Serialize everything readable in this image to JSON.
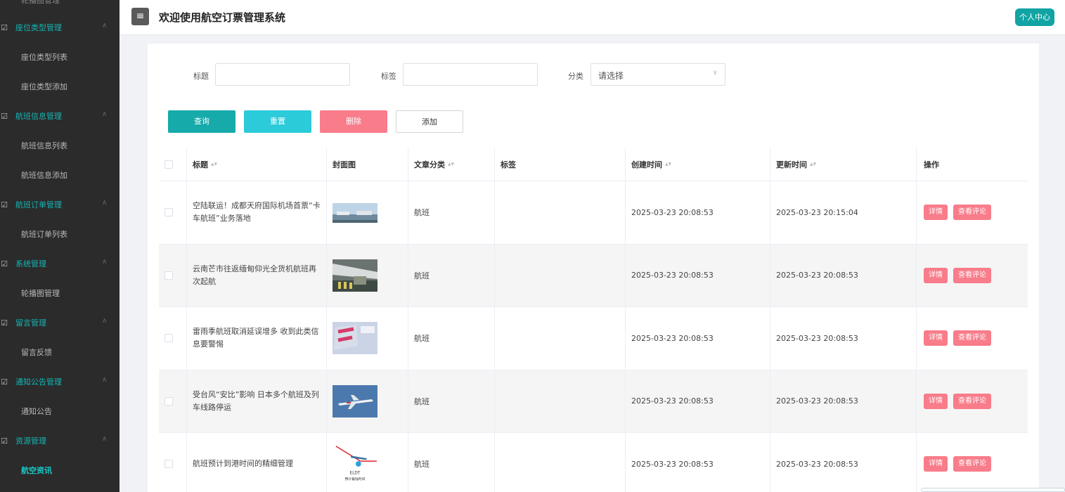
{
  "sidebar": {
    "top_item": "轮播图管理",
    "items": [
      {
        "type": "group",
        "label": "座位类型管理",
        "icon": "checkbox-icon"
      },
      {
        "type": "item",
        "label": "座位类型列表"
      },
      {
        "type": "item",
        "label": "座位类型添加"
      },
      {
        "type": "group",
        "label": "航班信息管理",
        "icon": "checkbox-icon"
      },
      {
        "type": "item",
        "label": "航班信息列表"
      },
      {
        "type": "item",
        "label": "航班信息添加"
      },
      {
        "type": "group",
        "label": "航班订单管理",
        "icon": "checkbox-icon"
      },
      {
        "type": "item",
        "label": "航班订单列表"
      },
      {
        "type": "group",
        "label": "系统管理",
        "icon": "checkbox-icon"
      },
      {
        "type": "item",
        "label": "轮播图管理"
      },
      {
        "type": "group",
        "label": "留言管理",
        "icon": "checkbox-icon"
      },
      {
        "type": "item",
        "label": "留言反馈"
      },
      {
        "type": "group",
        "label": "通知公告管理",
        "icon": "checkbox-icon"
      },
      {
        "type": "item",
        "label": "通知公告"
      },
      {
        "type": "group",
        "label": "资源管理",
        "icon": "checkbox-icon"
      },
      {
        "type": "item",
        "label": "航空资讯",
        "active": true
      }
    ]
  },
  "header": {
    "menu_icon": "≡",
    "title": "欢迎使用航空订票管理系统",
    "user_center": "个人中心"
  },
  "filters": {
    "title_label": "标题",
    "title_value": "",
    "tag_label": "标签",
    "tag_value": "",
    "category_label": "分类",
    "category_placeholder": "请选择"
  },
  "actions": {
    "search": "查询",
    "reset": "重置",
    "delete": "删除",
    "add": "添加"
  },
  "table": {
    "columns": {
      "title": "标题",
      "cover": "封面图",
      "category": "文章分类",
      "tags": "标签",
      "created": "创建时间",
      "updated": "更新时间",
      "ops": "操作"
    },
    "op_detail": "详情",
    "op_comments": "查看评论",
    "rows": [
      {
        "title": "空陆联运！成都天府国际机场首票“卡车航班”业务落地",
        "category": "航班",
        "tags": "",
        "created": "2025-03-23 20:08:53",
        "updated": "2025-03-23 20:15:04"
      },
      {
        "title": "云南芒市往返缅甸仰光全货机航班再次起航",
        "category": "航班",
        "tags": "",
        "created": "2025-03-23 20:08:53",
        "updated": "2025-03-23 20:08:53"
      },
      {
        "title": "雷雨季航班取消延误增多 收到此类信息要警惕",
        "category": "航班",
        "tags": "",
        "created": "2025-03-23 20:08:53",
        "updated": "2025-03-23 20:08:53"
      },
      {
        "title": "受台风“安比”影响 日本多个航班及列车线路停运",
        "category": "航班",
        "tags": "",
        "created": "2025-03-23 20:08:53",
        "updated": "2025-03-23 20:08:53"
      },
      {
        "title": "航班预计到港时间的精细管理",
        "category": "航班",
        "tags": "",
        "created": "2025-03-23 20:08:53",
        "updated": "2025-03-23 20:08:53"
      }
    ],
    "thumb5_text": [
      "ELDT",
      "预计着陆时间"
    ]
  }
}
